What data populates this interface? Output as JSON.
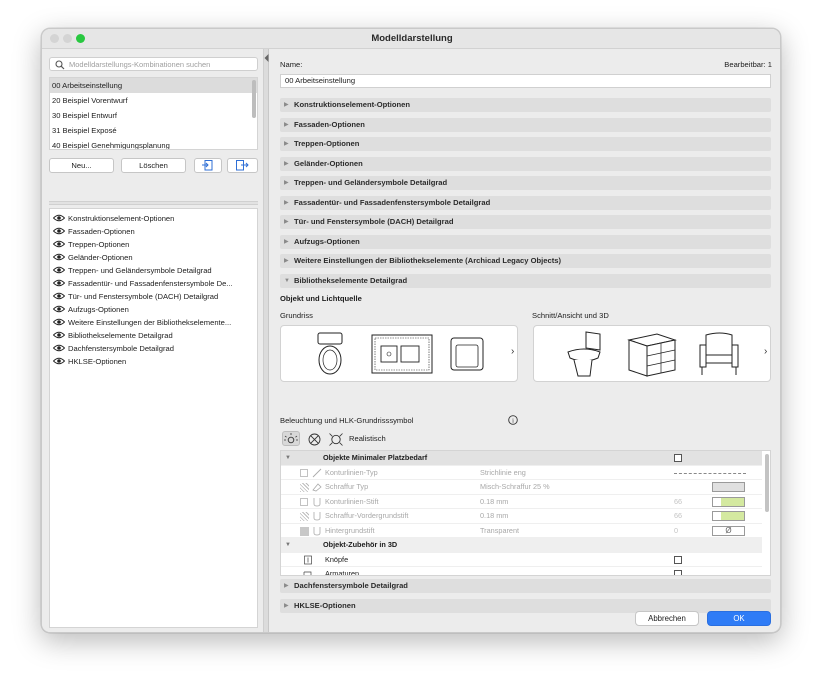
{
  "window": {
    "title": "Modelldarstellung"
  },
  "left": {
    "search_placeholder": "Modelldarstellungs-Kombinationen suchen",
    "combinations": [
      "00 Arbeitseinstellung",
      "20 Beispiel Vorentwurf",
      "30 Beispiel Entwurf",
      "31 Beispiel Exposé",
      "40 Beispiel Genehmigungsplanung"
    ],
    "buttons": {
      "new": "Neu...",
      "delete": "Löschen"
    },
    "options": [
      "Konstruktionselement-Optionen",
      "Fassaden-Optionen",
      "Treppen-Optionen",
      "Geländer-Optionen",
      "Treppen- und Geländersymbole Detailgrad",
      "Fassadentür- und Fassadenfenstersymbole De...",
      "Tür- und Fenstersymbole (DACH) Detailgrad",
      "Aufzugs-Optionen",
      "Weitere Einstellungen der Bibliothekselemente...",
      "Bibliothekselemente Detailgrad",
      "Dachfenstersymbole Detailgrad",
      "HKLSE-Optionen"
    ]
  },
  "right": {
    "name_label": "Name:",
    "editable_label": "Bearbeitbar: 1",
    "name_value": "00 Arbeitseinstellung",
    "sections": [
      "Konstruktionselement-Optionen",
      "Fassaden-Optionen",
      "Treppen-Optionen",
      "Geländer-Optionen",
      "Treppen- und Geländersymbole Detailgrad",
      "Fassadentür- und Fassadenfenstersymbole Detailgrad",
      "Tür- und Fenstersymbole (DACH) Detailgrad",
      "Aufzugs-Optionen",
      "Weitere Einstellungen der Bibliothekselemente (Archicad Legacy Objects)",
      "Bibliothekselemente Detailgrad"
    ],
    "expanded": {
      "subtitle": "Objekt und Lichtquelle",
      "grundriss_label": "Grundriss",
      "schnitt_label": "Schnitt/Ansicht und 3D",
      "lighting_label": "Beleuchtung und HLK-Grundrisssymbol",
      "lighting_mode": "Realistisch",
      "table": {
        "group1": "Objekte Minimaler Platzbedarf",
        "rows": [
          {
            "name": "Konturlinien-Typ",
            "value": "Strichlinie eng",
            "num": ""
          },
          {
            "name": "Schraffur Typ",
            "value": "Misch-Schraffur 25 %",
            "num": ""
          },
          {
            "name": "Konturlinien-Stift",
            "value": "0.18 mm",
            "num": "66"
          },
          {
            "name": "Schraffur-Vordergrundstift",
            "value": "0.18 mm",
            "num": "66"
          },
          {
            "name": "Hintergrundstift",
            "value": "Transparent",
            "num": "0"
          }
        ],
        "group2": "Objekt-Zubehör in 3D",
        "subrows": [
          "Knöpfe",
          "Armaturen"
        ]
      }
    },
    "bottom_sections": [
      "Dachfenstersymbole Detailgrad",
      "HKLSE-Optionen"
    ],
    "cancel": "Abbrechen",
    "ok": "OK"
  },
  "colors": {
    "accent": "#2f7cf6",
    "close": "#ff5f57",
    "minimize": "#febc2e",
    "zoom": "#28c840"
  }
}
